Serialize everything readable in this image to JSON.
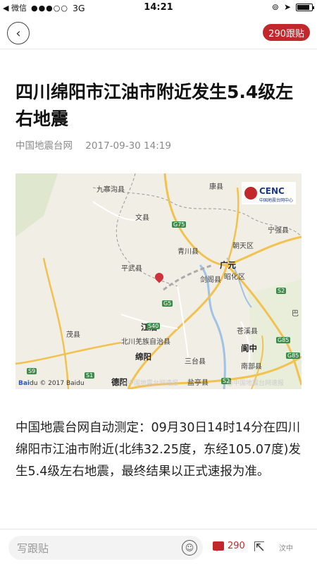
{
  "status_bar": {
    "back_app": "◀ 微信",
    "signal": "●●●○○",
    "network": "3G",
    "time": "14:21",
    "battery_level": 0.85
  },
  "nav": {
    "back_icon": "chevron-left-icon",
    "replies_label": "290跟贴"
  },
  "article": {
    "title": "四川绵阳市江油市附近发生5.4级左右地震",
    "source": "中国地震台网",
    "datetime": "2017-09-30 14:19",
    "body": "中国地震台网自动测定：09月30日14时14分在四川绵阳市江油市附近(北纬32.25度，东经105.07度)发生5.4级左右地震，最终结果以正式速报为准。"
  },
  "map": {
    "logo_text": "CENC",
    "logo_sub": "中国地震台网中心",
    "baidu_text": "© 2017 Baidu",
    "watermark": "@中国地震台网速报",
    "labels": [
      {
        "name": "九寨沟县"
      },
      {
        "name": "文县"
      },
      {
        "name": "康县"
      },
      {
        "name": "宁强县"
      },
      {
        "name": "朝天区"
      },
      {
        "name": "青川县"
      },
      {
        "name": "广元"
      },
      {
        "name": "平武县"
      },
      {
        "name": "昭化区"
      },
      {
        "name": "剑阁县"
      },
      {
        "name": "江油"
      },
      {
        "name": "北川羌族自治县"
      },
      {
        "name": "茂县"
      },
      {
        "name": "苍溪县"
      },
      {
        "name": "阆中"
      },
      {
        "name": "绵阳"
      },
      {
        "name": "三台县"
      },
      {
        "name": "南部县"
      },
      {
        "name": "德阳"
      },
      {
        "name": "盐亭县"
      },
      {
        "name": "巴"
      }
    ],
    "road_labels": [
      "G75",
      "G5",
      "S2",
      "S40",
      "S9",
      "G85",
      "S1",
      "S2",
      "G85"
    ]
  },
  "bottom_bar": {
    "reply_placeholder": "写跟贴",
    "comment_count": "290",
    "watermark": "汶中"
  }
}
